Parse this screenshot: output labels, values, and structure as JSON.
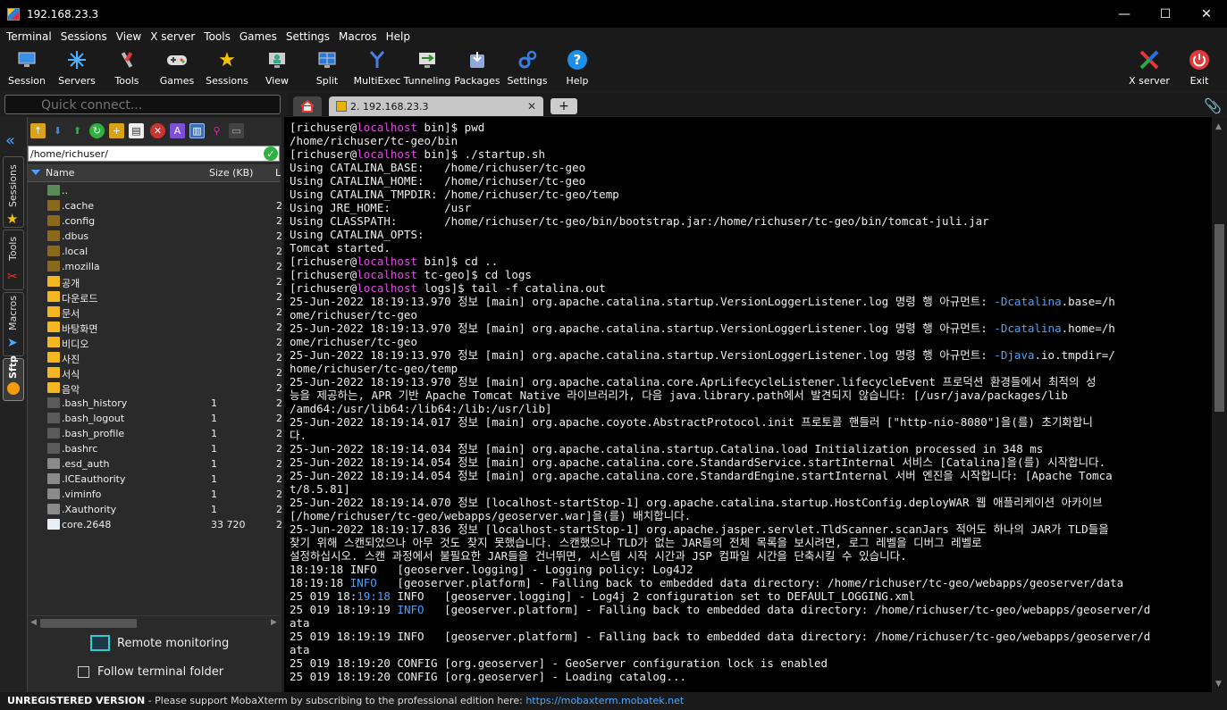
{
  "window": {
    "title": "192.168.23.3",
    "minimize": "—",
    "maximize": "☐",
    "close": "✕"
  },
  "menu": [
    "Terminal",
    "Sessions",
    "View",
    "X server",
    "Tools",
    "Games",
    "Settings",
    "Macros",
    "Help"
  ],
  "toolbar": {
    "session": "Session",
    "servers": "Servers",
    "tools": "Tools",
    "games": "Games",
    "sessions": "Sessions",
    "view": "View",
    "split": "Split",
    "multiexec": "MultiExec",
    "tunneling": "Tunneling",
    "packages": "Packages",
    "settings": "Settings",
    "help": "Help",
    "xserver": "X server",
    "exit": "Exit"
  },
  "quick_connect": {
    "placeholder": "Quick connect..."
  },
  "tabs": {
    "active": "2. 192.168.23.3",
    "close": "✕",
    "new": "+"
  },
  "side_tabs": {
    "sessions": "Sessions",
    "tools": "Tools",
    "macros": "Macros",
    "sftp": "Sftp"
  },
  "sftp": {
    "path": "/home/richuser/",
    "col_name": "Name",
    "col_size": "Size (KB)",
    "col_last": "L",
    "files": [
      {
        "name": "..",
        "size": "",
        "last": "",
        "type": "up"
      },
      {
        "name": ".cache",
        "size": "",
        "last": "2",
        "type": "folder-dark"
      },
      {
        "name": ".config",
        "size": "",
        "last": "2",
        "type": "folder-dark"
      },
      {
        "name": ".dbus",
        "size": "",
        "last": "2",
        "type": "folder-dark"
      },
      {
        "name": ".local",
        "size": "",
        "last": "2",
        "type": "folder-dark"
      },
      {
        "name": ".mozilla",
        "size": "",
        "last": "2",
        "type": "folder-dark"
      },
      {
        "name": "공개",
        "size": "",
        "last": "2",
        "type": "folder"
      },
      {
        "name": "다운로드",
        "size": "",
        "last": "2",
        "type": "folder"
      },
      {
        "name": "문서",
        "size": "",
        "last": "2",
        "type": "folder"
      },
      {
        "name": "바탕화면",
        "size": "",
        "last": "2",
        "type": "folder"
      },
      {
        "name": "비디오",
        "size": "",
        "last": "2",
        "type": "folder"
      },
      {
        "name": "사진",
        "size": "",
        "last": "2",
        "type": "folder"
      },
      {
        "name": "서식",
        "size": "",
        "last": "2",
        "type": "folder"
      },
      {
        "name": "음악",
        "size": "",
        "last": "2",
        "type": "folder"
      },
      {
        "name": ".bash_history",
        "size": "1",
        "last": "2",
        "type": "file-dark"
      },
      {
        "name": ".bash_logout",
        "size": "1",
        "last": "2",
        "type": "file-dark"
      },
      {
        "name": ".bash_profile",
        "size": "1",
        "last": "2",
        "type": "file-dark"
      },
      {
        "name": ".bashrc",
        "size": "1",
        "last": "2",
        "type": "file-dark"
      },
      {
        "name": ".esd_auth",
        "size": "1",
        "last": "2",
        "type": "file-gray"
      },
      {
        "name": ".ICEauthority",
        "size": "1",
        "last": "2",
        "type": "file-gray"
      },
      {
        "name": ".viminfo",
        "size": "1",
        "last": "2",
        "type": "file-gray"
      },
      {
        "name": ".Xauthority",
        "size": "1",
        "last": "2",
        "type": "file-gray"
      },
      {
        "name": "core.2648",
        "size": "33 720",
        "last": "2",
        "type": "file-white"
      }
    ],
    "remote_monitoring": "Remote monitoring",
    "follow_terminal": "Follow terminal folder"
  },
  "terminal": {
    "lines": [
      [
        {
          "t": "[richuser@"
        },
        {
          "t": "localhost",
          "c": "mag"
        },
        {
          "t": " bin]$ pwd"
        }
      ],
      [
        {
          "t": "/home/richuser/tc-geo/bin"
        }
      ],
      [
        {
          "t": "[richuser@"
        },
        {
          "t": "localhost",
          "c": "mag"
        },
        {
          "t": " bin]$ ./startup.sh"
        }
      ],
      [
        {
          "t": "Using CATALINA_BASE:   /home/richuser/tc-geo"
        }
      ],
      [
        {
          "t": "Using CATALINA_HOME:   /home/richuser/tc-geo"
        }
      ],
      [
        {
          "t": "Using CATALINA_TMPDIR: /home/richuser/tc-geo/temp"
        }
      ],
      [
        {
          "t": "Using JRE_HOME:        /usr"
        }
      ],
      [
        {
          "t": "Using CLASSPATH:       /home/richuser/tc-geo/bin/bootstrap.jar:/home/richuser/tc-geo/bin/tomcat-juli.jar"
        }
      ],
      [
        {
          "t": "Using CATALINA_OPTS:"
        }
      ],
      [
        {
          "t": "Tomcat started."
        }
      ],
      [
        {
          "t": "[richuser@"
        },
        {
          "t": "localhost",
          "c": "mag"
        },
        {
          "t": " bin]$ cd .."
        }
      ],
      [
        {
          "t": "[richuser@"
        },
        {
          "t": "localhost",
          "c": "mag"
        },
        {
          "t": " tc-geo]$ cd logs"
        }
      ],
      [
        {
          "t": "[richuser@"
        },
        {
          "t": "localhost",
          "c": "mag"
        },
        {
          "t": " logs]$ tail -f catalina.out"
        }
      ],
      [
        {
          "t": "25-Jun-2022 18:19:13.970 정보 [main] org.apache.catalina.startup.VersionLoggerListener.log 명령 행 아규먼트: "
        },
        {
          "t": "-Dcatalina",
          "c": "blu"
        },
        {
          "t": ".base=/h"
        }
      ],
      [
        {
          "t": "ome/richuser/tc-geo"
        }
      ],
      [
        {
          "t": "25-Jun-2022 18:19:13.970 정보 [main] org.apache.catalina.startup.VersionLoggerListener.log 명령 행 아규먼트: "
        },
        {
          "t": "-Dcatalina",
          "c": "blu"
        },
        {
          "t": ".home=/h"
        }
      ],
      [
        {
          "t": "ome/richuser/tc-geo"
        }
      ],
      [
        {
          "t": "25-Jun-2022 18:19:13.970 정보 [main] org.apache.catalina.startup.VersionLoggerListener.log 명령 행 아규먼트: "
        },
        {
          "t": "-Djava",
          "c": "blu"
        },
        {
          "t": ".io.tmpdir=/"
        }
      ],
      [
        {
          "t": "home/richuser/tc-geo/temp"
        }
      ],
      [
        {
          "t": "25-Jun-2022 18:19:13.970 정보 [main] org.apache.catalina.core.AprLifecycleListener.lifecycleEvent 프로덕션 환경들에서 최적의 성"
        }
      ],
      [
        {
          "t": "능을 제공하는, APR 기반 Apache Tomcat Native 라이브러리가, 다음 java.library.path에서 발견되지 않습니다: [/usr/java/packages/lib"
        }
      ],
      [
        {
          "t": "/amd64:/usr/lib64:/lib64:/lib:/usr/lib]"
        }
      ],
      [
        {
          "t": "25-Jun-2022 18:19:14.017 정보 [main] org.apache.coyote.AbstractProtocol.init 프로토콜 핸들러 [\"http-nio-8080\"]을(를) 초기화합니"
        }
      ],
      [
        {
          "t": "다."
        }
      ],
      [
        {
          "t": "25-Jun-2022 18:19:14.034 정보 [main] org.apache.catalina.startup.Catalina.load Initialization processed in 348 ms"
        }
      ],
      [
        {
          "t": "25-Jun-2022 18:19:14.054 정보 [main] org.apache.catalina.core.StandardService.startInternal 서비스 [Catalina]을(를) 시작합니다."
        }
      ],
      [
        {
          "t": "25-Jun-2022 18:19:14.054 정보 [main] org.apache.catalina.core.StandardEngine.startInternal 서버 엔진을 시작합니다: [Apache Tomca"
        }
      ],
      [
        {
          "t": "t/8.5.81]"
        }
      ],
      [
        {
          "t": "25-Jun-2022 18:19:14.070 정보 [localhost-startStop-1] org.apache.catalina.startup.HostConfig.deployWAR 웹 애플리케이션 아카이브"
        }
      ],
      [
        {
          "t": "[/home/richuser/tc-geo/webapps/geoserver.war]을(를) 배치합니다."
        }
      ],
      [
        {
          "t": "25-Jun-2022 18:19:17.836 정보 [localhost-startStop-1] org.apache.jasper.servlet.TldScanner.scanJars 적어도 하나의 JAR가 TLD들을"
        }
      ],
      [
        {
          "t": "찾기 위해 스캔되었으나 아무 것도 찾지 못했습니다. 스캔했으나 TLD가 없는 JAR들의 전체 목록을 보시려면, 로그 레벨을 디버그 레벨로"
        }
      ],
      [
        {
          "t": "설정하십시오. 스캔 과정에서 불필요한 JAR들을 건너뛰면, 시스템 시작 시간과 JSP 컴파일 시간을 단축시킬 수 있습니다."
        }
      ],
      [
        {
          "t": "18:19:18 INFO   [geoserver.logging] - Logging policy: Log4J2"
        }
      ],
      [
        {
          "t": "18:19:18 "
        },
        {
          "t": "INFO",
          "c": "blu"
        },
        {
          "t": "   [geoserver.platform] - Falling back to embedded data directory: /home/richuser/tc-geo/webapps/geoserver/data"
        }
      ],
      [
        {
          "t": "25 019 18:"
        },
        {
          "t": "19:18",
          "c": "blu"
        },
        {
          "t": " INFO   [geoserver.logging] - Log4j 2 configuration set to DEFAULT_LOGGING.xml"
        }
      ],
      [
        {
          "t": "25 019 18:19:19 "
        },
        {
          "t": "INFO",
          "c": "blu"
        },
        {
          "t": "   [geoserver.platform] - Falling back to embedded data directory: /home/richuser/tc-geo/webapps/geoserver/d"
        }
      ],
      [
        {
          "t": "ata"
        }
      ],
      [
        {
          "t": "25 019 18:19:19 INFO   [geoserver.platform] - Falling back to embedded data directory: /home/richuser/tc-geo/webapps/geoserver/d"
        }
      ],
      [
        {
          "t": "ata"
        }
      ],
      [
        {
          "t": "25 019 18:19:20 CONFIG [org.geoserver] - GeoServer configuration lock is enabled"
        }
      ],
      [
        {
          "t": "25 019 18:19:20 CONFIG [org.geoserver] - Loading catalog..."
        }
      ]
    ]
  },
  "status": {
    "unregistered": "UNREGISTERED VERSION",
    "message": " -  Please support MobaXterm by subscribing to the professional edition here: ",
    "link": "https://mobaxterm.mobatek.net"
  }
}
